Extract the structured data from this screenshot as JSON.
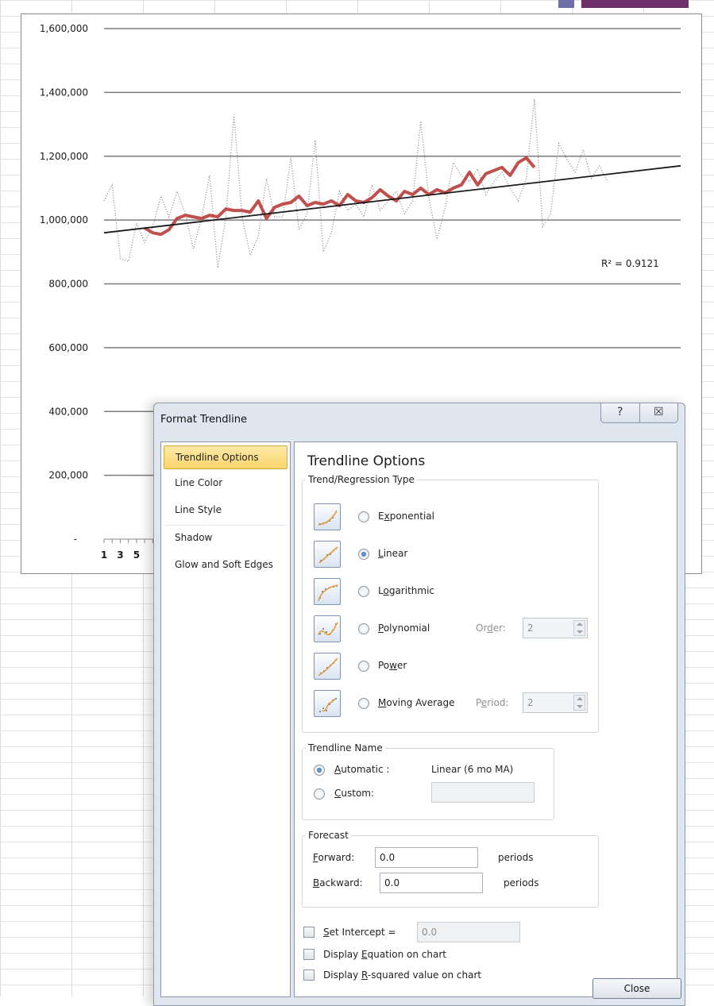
{
  "chart_data": {
    "type": "line",
    "y_ticks": [
      "1,600,000",
      "1,400,000",
      "1,200,000",
      "1,000,000",
      "800,000",
      "600,000",
      "400,000",
      "200,000",
      "-"
    ],
    "ylim": [
      0,
      1600000
    ],
    "x_ticks_visible": [
      "1",
      "3",
      "5"
    ],
    "x": [
      1,
      2,
      3,
      4,
      5,
      6,
      7,
      8,
      9,
      10,
      11,
      12,
      13,
      14,
      15,
      16,
      17,
      18,
      19,
      20,
      21,
      22,
      23,
      24,
      25,
      26,
      27,
      28,
      29,
      30,
      31,
      32,
      33,
      34,
      35,
      36,
      37,
      38,
      39,
      40,
      41,
      42,
      43,
      44,
      45,
      46,
      47,
      48,
      49,
      50,
      51,
      52,
      53,
      54,
      55,
      56,
      57,
      58,
      59,
      60,
      61,
      62,
      63,
      64,
      65,
      66,
      67,
      68,
      69,
      70,
      71,
      72
    ],
    "series": [
      {
        "style": "dotted",
        "color": "#9a9a9a",
        "values": [
          1060000,
          1110000,
          880000,
          870000,
          990000,
          930000,
          980000,
          1075000,
          1010000,
          1090000,
          1020000,
          910000,
          1005000,
          1140000,
          850000,
          1010000,
          1330000,
          1010000,
          890000,
          950000,
          1130000,
          1010000,
          1010000,
          1195000,
          970000,
          1020000,
          1250000,
          900000,
          960000,
          1090000,
          1030000,
          1050000,
          1010000,
          1110000,
          1030000,
          1060000,
          1090000,
          1020000,
          1060000,
          1310000,
          1070000,
          940000,
          1040000,
          1180000,
          1140000,
          1120000,
          1160000,
          1080000,
          1120000,
          1150000,
          1100000,
          1060000,
          1130000,
          1380000,
          980000,
          1020000,
          1240000,
          1190000,
          1150000,
          1220000,
          1130000,
          1170000,
          1120000
        ]
      },
      {
        "name": "Linear (6 mo MA)",
        "style": "solid",
        "color": "#c0504d",
        "values": [
          null,
          null,
          null,
          null,
          null,
          975000,
          960000,
          955000,
          970000,
          1005000,
          1015000,
          1010000,
          1005000,
          1015000,
          1010000,
          1035000,
          1030000,
          1030000,
          1025000,
          1060000,
          1005000,
          1040000,
          1050000,
          1055000,
          1075000,
          1045000,
          1055000,
          1050000,
          1060000,
          1045000,
          1080000,
          1060000,
          1055000,
          1070000,
          1095000,
          1075000,
          1060000,
          1090000,
          1080000,
          1100000,
          1080000,
          1095000,
          1085000,
          1100000,
          1110000,
          1150000,
          1110000,
          1145000,
          1155000,
          1165000,
          1140000,
          1180000,
          1195000,
          1165000
        ]
      }
    ],
    "trendline": {
      "type": "linear",
      "start": 960000,
      "end": 1170000,
      "r_squared_label": "R² = 0.9121"
    },
    "grid": true
  },
  "dialog": {
    "title": "Format Trendline",
    "help_glyph": "?",
    "close_glyph": "☒",
    "nav": [
      "Trendline Options",
      "Line Color",
      "Line Style",
      "Shadow",
      "Glow and Soft Edges"
    ],
    "panel_title": "Trendline Options",
    "trend_group_label": "Trend/Regression Type",
    "types": [
      {
        "pre": "E",
        "key": "x",
        "post": "ponential",
        "checked": false
      },
      {
        "pre": "",
        "key": "L",
        "post": "inear",
        "checked": true
      },
      {
        "pre": "L",
        "key": "o",
        "post": "garithmic",
        "checked": false
      },
      {
        "pre": "",
        "key": "P",
        "post": "olynomial",
        "checked": false
      },
      {
        "pre": "Po",
        "key": "w",
        "post": "er",
        "checked": false
      },
      {
        "pre": "",
        "key": "M",
        "post": "oving Average",
        "checked": false
      }
    ],
    "order_label": {
      "pre": "Or",
      "key": "d",
      "post": "er:"
    },
    "order_value": "2",
    "period_label": {
      "pre": "P",
      "key": "e",
      "post": "riod:"
    },
    "period_value": "2",
    "name_group_label": "Trendline Name",
    "automatic": {
      "key": "A",
      "post": "utomatic :",
      "checked": true
    },
    "automatic_value": "Linear (6 mo MA)",
    "custom": {
      "key": "C",
      "post": "ustom:",
      "checked": false
    },
    "custom_value": "",
    "forecast_group_label": "Forecast",
    "forward": {
      "key": "F",
      "post": "orward:"
    },
    "forward_value": "0.0",
    "backward": {
      "key": "B",
      "post": "ackward:"
    },
    "backward_value": "0.0",
    "periods_label": "periods",
    "set_intercept": {
      "key": "S",
      "post": "et Intercept ="
    },
    "set_intercept_value": "0.0",
    "display_equation": {
      "pre": "Display ",
      "key": "E",
      "post": "quation on chart"
    },
    "display_rsquared": {
      "pre": "Display ",
      "key": "R",
      "post": "-squared value on chart"
    },
    "close_label": "Close"
  }
}
